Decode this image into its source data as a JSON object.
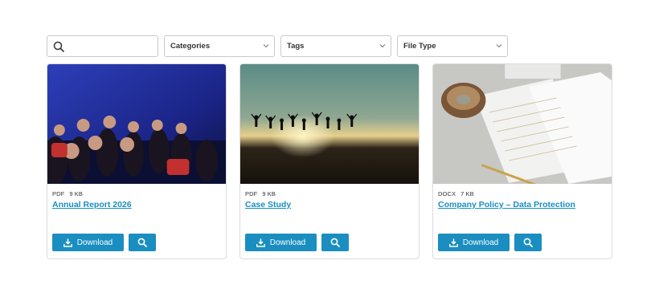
{
  "filters": {
    "search_placeholder": "",
    "categories_label": "Categories",
    "tags_label": "Tags",
    "file_type_label": "File Type"
  },
  "cards": [
    {
      "file_type": "PDF",
      "file_size": "9 KB",
      "title": "Annual Report 2026",
      "download_label": "Download",
      "image": "audience-in-theater-photo"
    },
    {
      "file_type": "PDF",
      "file_size": "9 KB",
      "title": "Case Study",
      "download_label": "Download",
      "image": "people-jumping-at-sunset-photo"
    },
    {
      "file_type": "DOCX",
      "file_size": "7 KB",
      "title": "Company Policy – Data Protection",
      "download_label": "Download",
      "image": "documents-and-pen-on-desk-photo"
    }
  ],
  "colors": {
    "accent": "#1a8ec0",
    "border": "#dcdcdc"
  },
  "icons": {
    "search": "search-icon",
    "chevron": "chevron-down-icon",
    "download": "download-icon",
    "zoom": "magnifier-icon"
  }
}
